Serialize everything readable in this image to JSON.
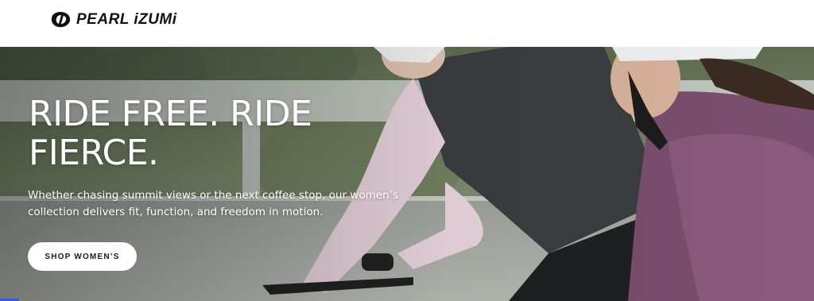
{
  "header": {
    "brand": "PEARL iZUMi",
    "logo_icon": "pearl-izumi-swirl-logo"
  },
  "hero": {
    "title": "RIDE FREE. RIDE FIERCE.",
    "subtitle": "Whether chasing summit views or the next coffee stop, our women’s collection delivers fit, function, and freedom in motion.",
    "cta_label": "SHOP WOMEN’S",
    "image_description_icon": "cyclists-photo"
  },
  "colors": {
    "cta_bg": "#ffffff",
    "cta_text": "#1a1a1a",
    "title_text": "#ffffff",
    "accent_indicator": "#2f5be0"
  }
}
